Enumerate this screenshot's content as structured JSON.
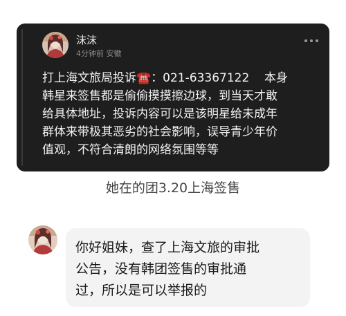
{
  "post": {
    "user_name": "沫沫",
    "meta": "4分钟前 安徽",
    "body": "打上海文旅局投诉☎️：021-63367122    本身\n韩星来签售都是偷偷摸摸擦边球，到当天才敢\n给具体地址，投诉内容可以是该明星给未成年\n群体来带极其恶劣的社会影响，误导青少年价\n值观，不符合清朗的网络氛围等等",
    "avatar_icon": "user-avatar-icon",
    "more_icon": "more-dots-icon"
  },
  "caption": "她在的团3.20上海签售",
  "reply": {
    "text": "你好姐妹，查了上海文旅的审批\n公告，没有韩团签售的审批通\n过，所以是可以举报的",
    "avatar_icon": "user-avatar-icon"
  },
  "colors": {
    "card_background": "#1e1e1e",
    "bubble_background": "#f3f3f3",
    "page_background": "#ffffff"
  }
}
